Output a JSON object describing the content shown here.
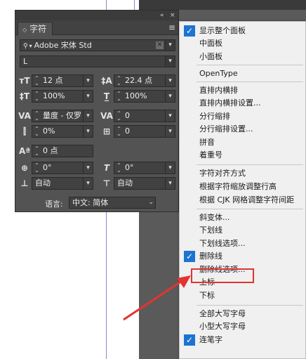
{
  "panel": {
    "tab_label": "字符",
    "font_family": "Adobe 宋体 Std",
    "font_style": "L",
    "font_size": "12 点",
    "leading": "22.4 点",
    "vertical_scale": "100%",
    "horizontal_scale": "100%",
    "kerning": "量度 - 仅罗",
    "tracking": "0",
    "tsume": "0%",
    "mojikumi": "0",
    "baseline_shift": "0 点",
    "rotation": "0°",
    "skew": "0°",
    "aki_left": "自动",
    "aki_right": "自动",
    "language_label": "语言:",
    "language_value": "中文: 简体",
    "icons": {
      "collapse": "«",
      "close": "×",
      "menu": "≡",
      "search": "🔍"
    }
  },
  "menu": {
    "items": [
      {
        "label": "显示整个面板",
        "checked": true
      },
      {
        "label": "中面板",
        "checked": false
      },
      {
        "label": "小面板",
        "checked": false
      },
      {
        "label": "OpenType",
        "checked": false
      },
      {
        "label": "直排内横排",
        "checked": false
      },
      {
        "label": "直排内横排设置...",
        "checked": false
      },
      {
        "label": "分行缩排",
        "checked": false
      },
      {
        "label": "分行缩排设置...",
        "checked": false
      },
      {
        "label": "拼音",
        "checked": false
      },
      {
        "label": "着重号",
        "checked": false
      },
      {
        "label": "字符对齐方式",
        "checked": false
      },
      {
        "label": "根据字符缩放调整行高",
        "checked": false
      },
      {
        "label": "根据 CJK 网格调整字符间距",
        "checked": false
      },
      {
        "label": "斜变体...",
        "checked": false
      },
      {
        "label": "下划线",
        "checked": false
      },
      {
        "label": "下划线选项...",
        "checked": false
      },
      {
        "label": "删除线",
        "checked": true
      },
      {
        "label": "删除线选项...",
        "checked": false
      },
      {
        "label": "上标",
        "checked": false
      },
      {
        "label": "下标",
        "checked": false
      },
      {
        "label": "全部大写字母",
        "checked": false
      },
      {
        "label": "小型大写字母",
        "checked": false
      },
      {
        "label": "连笔字",
        "checked": true
      }
    ],
    "check_color": "#1e73d2"
  },
  "annotation": {
    "color": "#e3342f"
  }
}
